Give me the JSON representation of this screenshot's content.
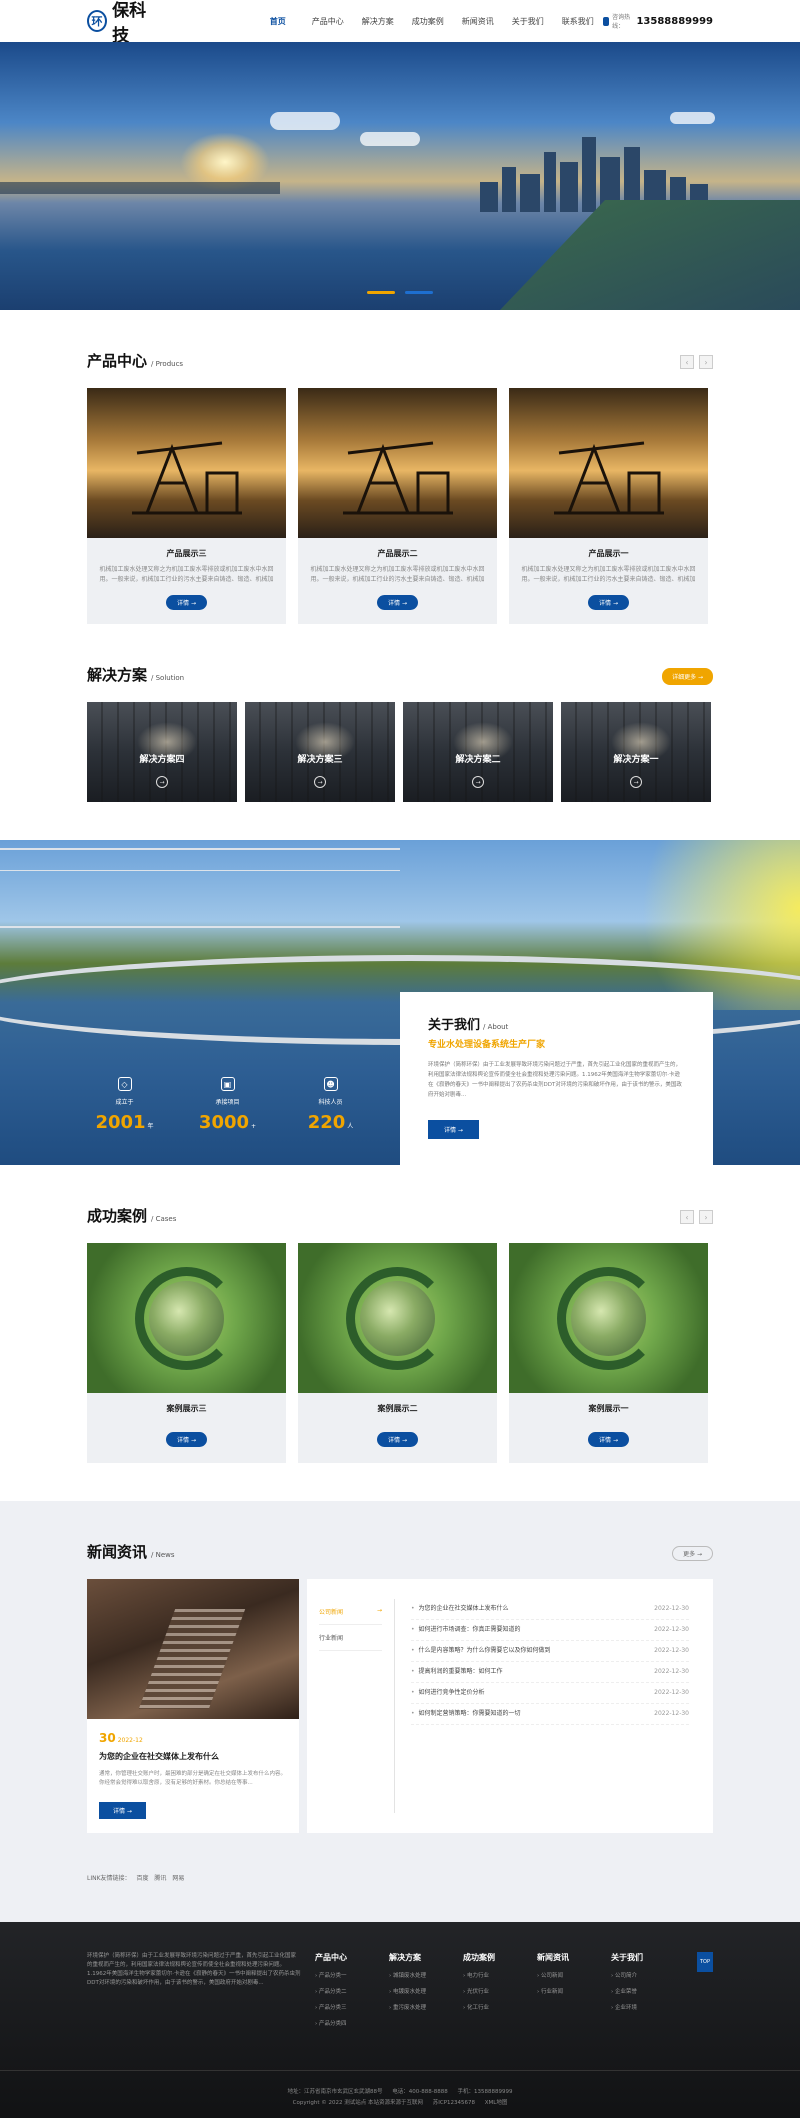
{
  "header": {
    "logo_mark": "环",
    "logo_text": "保科技",
    "nav": [
      "首页",
      "产品中心",
      "解决方案",
      "成功案例",
      "新闻资讯",
      "关于我们",
      "联系我们"
    ],
    "phone_label": "咨询热线：",
    "phone": "13588889999"
  },
  "products": {
    "title": "产品中心",
    "subtitle": "/ Producs",
    "items": [
      {
        "title": "产品展示三",
        "desc": "机械加工废水处理又称之为机加工废水零排放或机加工废水中水回用。一般来说，机械加工行业的污水主要来自铸造、锻造、机械加",
        "btn": "详情 →"
      },
      {
        "title": "产品展示二",
        "desc": "机械加工废水处理又称之为机加工废水零排放或机加工废水中水回用。一般来说，机械加工行业的污水主要来自铸造、锻造、机械加",
        "btn": "详情 →"
      },
      {
        "title": "产品展示一",
        "desc": "机械加工废水处理又称之为机加工废水零排放或机加工废水中水回用。一般来说，机械加工行业的污水主要来自铸造、锻造、机械加",
        "btn": "详情 →"
      }
    ]
  },
  "solutions": {
    "title": "解决方案",
    "subtitle": "/ Solution",
    "more": "详细更多 →",
    "items": [
      "解决方案四",
      "解决方案三",
      "解决方案二",
      "解决方案一"
    ]
  },
  "about": {
    "title": "关于我们",
    "subtitle": "/ About",
    "slogan": "专业水处理设备系统生产厂家",
    "text": "环境保护（简称环保）由于工业发展导致环境污染问题过于严重，首先引起工业化国家的重视而产生的，利用国家法律法规和舆论宣传而使全社会重视和处理污染问题。1.1962年美国海洋生物学家蕾切尔·卡逊在《寂静的春天》一书中阐释提出了农药杀虫剂DDT对环境的污染和破坏作用，由于该书的警示，美国政府开始对剧毒...",
    "btn": "详情 →",
    "stats": [
      {
        "label": "成立于",
        "value": "2001",
        "unit": "年"
      },
      {
        "label": "承接项目",
        "value": "3000",
        "unit": "+"
      },
      {
        "label": "科技人员",
        "value": "220",
        "unit": "人"
      }
    ]
  },
  "cases": {
    "title": "成功案例",
    "subtitle": "/ Cases",
    "items": [
      {
        "title": "案例展示三",
        "btn": "详情 →"
      },
      {
        "title": "案例展示二",
        "btn": "详情 →"
      },
      {
        "title": "案例展示一",
        "btn": "详情 →"
      }
    ]
  },
  "news": {
    "title": "新闻资讯",
    "subtitle": "/ News",
    "more": "更多 →",
    "featured": {
      "day": "30",
      "month": "2022-12",
      "title": "为您的企业在社交媒体上发布什么",
      "text": "通常，你管理社交账户时，最困难的部分是确定在社交媒体上发布什么内容。你经常会觉得难以取舍原，没有足够的好素材。你总结在等事...",
      "btn": "详情 →"
    },
    "tabs": [
      "公司新闻",
      "行业新闻"
    ],
    "list": [
      {
        "title": "为您的企业在社交媒体上发布什么",
        "date": "2022-12-30"
      },
      {
        "title": "如何进行市场调查：你真正需要知道的",
        "date": "2022-12-30"
      },
      {
        "title": "什么是内容策略？为什么你需要它以及你如何做到",
        "date": "2022-12-30"
      },
      {
        "title": "提高利润的重要策略：如何工作",
        "date": "2022-12-30"
      },
      {
        "title": "如何进行竞争性定价分析",
        "date": "2022-12-30"
      },
      {
        "title": "如何制定营销策略：你需要知道的一切",
        "date": "2022-12-30"
      }
    ],
    "links_label": "LINK友情链接：",
    "links": [
      "百度",
      "腾讯",
      "网易"
    ]
  },
  "footer": {
    "about": "环境保护（简称环保）由于工业发展导致环境污染问题过于严重，首先引起工业化国家的重视而产生的，利用国家法律法规和舆论宣传而使全社会重视和处理污染问题。1.1962年美国海洋生物学家蕾切尔·卡逊在《寂静的春天》一书中阐释提出了农药杀虫剂DDT对环境的污染和破坏作用，由于该书的警示，美国政府开始对剧毒...",
    "cols": [
      {
        "title": "产品中心",
        "links": [
          "› 产品分类一",
          "› 产品分类二",
          "› 产品分类三",
          "› 产品分类四"
        ]
      },
      {
        "title": "解决方案",
        "links": [
          "› 城镇废水处理",
          "› 电镀废水处理",
          "› 重污废水处理"
        ]
      },
      {
        "title": "成功案例",
        "links": [
          "› 电力行业",
          "› 光伏行业",
          "› 化工行业"
        ]
      },
      {
        "title": "新闻资讯",
        "links": [
          "› 公司新闻",
          "› 行业新闻"
        ]
      },
      {
        "title": "关于我们",
        "links": [
          "› 公司简介",
          "› 企业荣誉",
          "› 企业环境"
        ]
      }
    ],
    "top": "TOP",
    "contact": [
      "地址：江苏省南京市玄武区玄武湖88号",
      "电话：400-888-8888",
      "手机：13588889999"
    ],
    "copyright": [
      "Copyright © 2022 测试站点 本站资源来源于互联网",
      "苏ICP12345678",
      "XML地图"
    ]
  }
}
